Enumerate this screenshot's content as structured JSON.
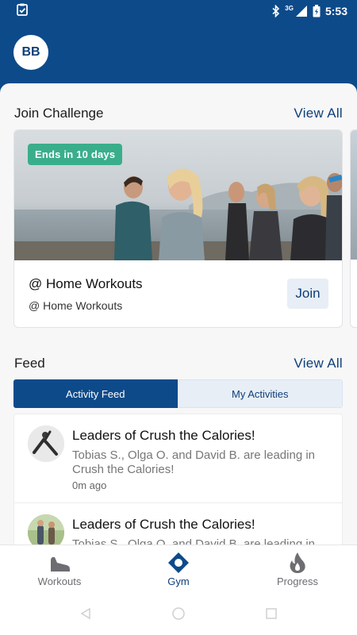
{
  "status_bar": {
    "network": "3G",
    "time": "5:53"
  },
  "header": {
    "avatar_initials": "BB"
  },
  "challenges": {
    "title": "Join Challenge",
    "view_all": "View All",
    "card": {
      "badge": "Ends in 10 days",
      "name": "@ Home Workouts",
      "subtitle": "@ Home Workouts",
      "join_label": "Join"
    }
  },
  "feed": {
    "title": "Feed",
    "view_all": "View All",
    "tabs": [
      {
        "label": "Activity Feed",
        "active": true
      },
      {
        "label": "My Activities",
        "active": false
      }
    ],
    "items": [
      {
        "title": "Leaders of Crush the Calories!",
        "description": "Tobias S., Olga O. and David B. are leading in Crush the Calories!",
        "time": "0m ago"
      },
      {
        "title": "Leaders of Crush the Calories!",
        "description": "Tobias S., Olga O. and David B. are leading in",
        "time": ""
      }
    ]
  },
  "bottom_nav": {
    "items": [
      {
        "label": "Workouts",
        "icon": "sneaker-icon",
        "active": false
      },
      {
        "label": "Gym",
        "icon": "gym-diamond-icon",
        "active": true
      },
      {
        "label": "Progress",
        "icon": "flame-icon",
        "active": false
      }
    ]
  },
  "colors": {
    "brand": "#0d4a8a",
    "badge": "#3aae8a",
    "tab_inactive_bg": "#e8eef6"
  }
}
